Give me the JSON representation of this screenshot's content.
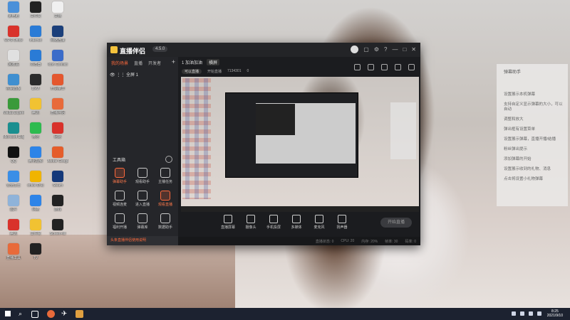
{
  "desktop_icons": [
    {
      "label": "此电脑",
      "icon": "computer-icon",
      "color": "#4a90d9"
    },
    {
      "label": "文件夹",
      "icon": "app-icon",
      "color": "#222222"
    },
    {
      "label": "文档",
      "icon": "file-icon",
      "color": "#f0f0f0"
    },
    {
      "label": "WPS Office",
      "icon": "wps-icon",
      "color": "#d9322b"
    },
    {
      "label": "Internet",
      "icon": "ie-icon",
      "color": "#2a7bd6"
    },
    {
      "label": "网络连接",
      "icon": "network-icon",
      "color": "#1b3f7a"
    },
    {
      "label": "回收站",
      "icon": "recycle-icon",
      "color": "#e0e0e0"
    },
    {
      "label": "浏览器",
      "icon": "browser-icon",
      "color": "#2a7bd6"
    },
    {
      "label": "Icon Conflict",
      "icon": "ie-icon",
      "color": "#3b6cc9"
    },
    {
      "label": "控制面板",
      "icon": "control-panel-icon",
      "color": "#3f8fd0"
    },
    {
      "label": "DxVI",
      "icon": "app-icon",
      "color": "#2b2b2b"
    },
    {
      "label": "开始菜单",
      "icon": "app-icon",
      "color": "#e4572e"
    },
    {
      "label": "Nvidia Experience",
      "icon": "nvidia-icon",
      "color": "#3a9a3a"
    },
    {
      "label": "腾讯",
      "icon": "app-icon",
      "color": "#f1c232"
    },
    {
      "label": "直播伴侣",
      "icon": "live-icon",
      "color": "#e86a3a"
    },
    {
      "label": "Microsoft Edge",
      "icon": "edge-icon",
      "color": "#1a8f8f"
    },
    {
      "label": "微信",
      "icon": "wechat-icon",
      "color": "#2dbb4f"
    },
    {
      "label": "网易",
      "icon": "app-icon",
      "color": "#d9322b"
    },
    {
      "label": "QQ",
      "icon": "qq-icon",
      "color": "#111111"
    },
    {
      "label": "腾讯视频",
      "icon": "app-icon",
      "color": "#2d84e8"
    },
    {
      "label": "Adobe Google",
      "icon": "app-icon",
      "color": "#e55d2a"
    },
    {
      "label": "安全卫士",
      "icon": "shield-icon",
      "color": "#3a8ee6"
    },
    {
      "label": "office 办公",
      "icon": "office-icon",
      "color": "#f0b400"
    },
    {
      "label": "Steam",
      "icon": "steam-icon",
      "color": "#15397a"
    },
    {
      "label": "图片",
      "icon": "image-icon",
      "color": "#8fb3d9"
    },
    {
      "label": "网络",
      "icon": "network-icon",
      "color": "#2d84e8"
    },
    {
      "label": "游戏",
      "icon": "game-icon",
      "color": "#222222"
    },
    {
      "label": "腾讯",
      "icon": "app-icon",
      "color": "#d9322b"
    },
    {
      "label": "文件夹",
      "icon": "folder-icon",
      "color": "#f1c232"
    },
    {
      "label": "Screen-fill",
      "icon": "app-icon",
      "color": "#222222"
    },
    {
      "label": "直播工具",
      "icon": "app-icon",
      "color": "#e86a3a"
    },
    {
      "label": "TV",
      "icon": "app-icon",
      "color": "#222222"
    }
  ],
  "app": {
    "name": "直播伴侣",
    "version_badge": "4.5.0",
    "left_tabs": [
      "我的场景",
      "直播",
      "开发者"
    ],
    "add_label": "+",
    "scene_label": "全屏 1",
    "toolbox_title": "工具箱",
    "tools": [
      {
        "label": "弹幕助手",
        "hot": true
      },
      {
        "label": "观看助手",
        "hot": false
      },
      {
        "label": "主播任务",
        "hot": false
      },
      {
        "label": "视频连麦",
        "hot": false
      },
      {
        "label": "进入直播",
        "hot": false
      },
      {
        "label": "观看直播",
        "hot": true
      },
      {
        "label": "福利开播",
        "hot": false
      },
      {
        "label": "弹幕库",
        "hot": false
      },
      {
        "label": "数据助手",
        "hot": false
      }
    ],
    "notice": "头条直播伴侣使用说明",
    "right_tabs": [
      "1 加油加油",
      "横屏"
    ],
    "sub_tags": [
      "可以直播",
      "开始直播",
      "7134301",
      "0"
    ],
    "controls": [
      "直播屏幕",
      "摄像头",
      "手机投屏",
      "多媒体",
      "麦克风",
      "扬声器"
    ],
    "live_button": "开始直播",
    "status_items": [
      "直播状态: 0",
      "CPU: 20",
      "内存: 20%",
      "帧率: 30",
      "码率: 0"
    ]
  },
  "side_panel": {
    "title": "弹幕助手",
    "items": [
      "设置展示本机弹幕",
      "支持自定义显示弹幕的大小，可以自动",
      "调整和放大",
      "弹出框有设置菜单",
      "设置展示弹幕，直播开播/结播",
      "粉丝弹出提示",
      "添加弹幕的开始",
      "设置展示收到的礼物、消息",
      "点击将设置小礼物弹幕"
    ]
  },
  "taskbar": {
    "apps": [
      "search-icon",
      "task-view-icon",
      "live-icon",
      "plane-icon",
      "app-icon"
    ],
    "time": "8:25",
    "date": "2021/9/10"
  }
}
